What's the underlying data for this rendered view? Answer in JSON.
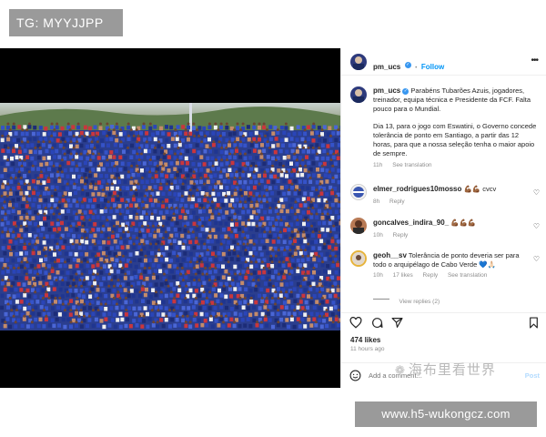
{
  "watermark_top": "TG: MYYJJPP",
  "watermark_bottom": "www.h5-wukongcz.com",
  "watermark_cn": "海布里看世界",
  "header": {
    "username": "pm_ucs",
    "separator": "•",
    "follow_label": "Follow",
    "more_icon": "more-horizontal-icon"
  },
  "caption": {
    "username": "pm_ucs",
    "paragraph1": "Parabéns Tubarões Azuis, jogadores, treinador, equipa técnica e Presidente da FCF. Falta pouco para o Mundial.",
    "paragraph2": "Dia 13, para o jogo com Eswatini, o Governo concede tolerância de ponto em Santiago, a partir das 12 horas, para que a nossa seleção tenha o maior apoio de sempre.",
    "time": "11h",
    "see_translation": "See translation"
  },
  "comments": [
    {
      "username": "elmer_rodrigues10mosso",
      "text": "💪🏾💪🏾 cvcv",
      "time": "8h",
      "likes": "",
      "reply": "Reply",
      "see_translation": ""
    },
    {
      "username": "goncalves_indira_90_",
      "text": "💪🏾💪🏾💪🏾",
      "time": "10h",
      "likes": "",
      "reply": "Reply",
      "see_translation": ""
    },
    {
      "username": "geoh__sv",
      "text": "Tolerância de ponto deveria ser para todo o arquipélago de Cabo Verde 💙🙏🏻",
      "time": "10h",
      "likes": "17 likes",
      "reply": "Reply",
      "see_translation": "See translation"
    }
  ],
  "view_replies": "View replies (2)",
  "actions": {
    "like_icon": "heart-icon",
    "comment_icon": "comment-icon",
    "share_icon": "send-icon",
    "save_icon": "bookmark-icon"
  },
  "likes_count": "474 likes",
  "posted_ago": "11 hours ago",
  "add_comment": {
    "placeholder": "Add a comment...",
    "post_label": "Post",
    "emoji_icon": "emoji-icon"
  },
  "colors": {
    "follow_blue": "#0095f6",
    "verified_blue": "#3897f0",
    "watermark_gray": "#9a9a9a",
    "crowd_blue": "#2a45b8"
  }
}
